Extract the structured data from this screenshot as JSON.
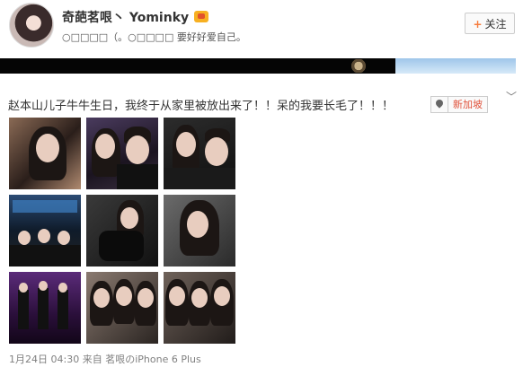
{
  "user": {
    "name": "奇葩茗哏丶 Yominky",
    "signature": "○□□□□（。○□□□□ 要好好爱自己。"
  },
  "follow_button": {
    "label": "关注",
    "plus": "+"
  },
  "post": {
    "text": "赵本山儿子牛牛生日，我终于从家里被放出来了！！呆的我要长毛了！！！",
    "location": "新加坡",
    "photos": [
      {
        "desc": "selfie"
      },
      {
        "desc": "selfie-pair"
      },
      {
        "desc": "pair-dark"
      },
      {
        "desc": "group-bar"
      },
      {
        "desc": "girl-phone"
      },
      {
        "desc": "girl-sofa"
      },
      {
        "desc": "group-purple"
      },
      {
        "desc": "group-selfie"
      },
      {
        "desc": "group-selfie-2"
      }
    ]
  },
  "meta": {
    "timestamp": "1月24日 04:30",
    "source_prefix": "来自",
    "source": "茗哏のiPhone 6 Plus"
  },
  "colors": {
    "accent": "#f77c3d",
    "location": "#e0513a",
    "muted": "#808080"
  }
}
